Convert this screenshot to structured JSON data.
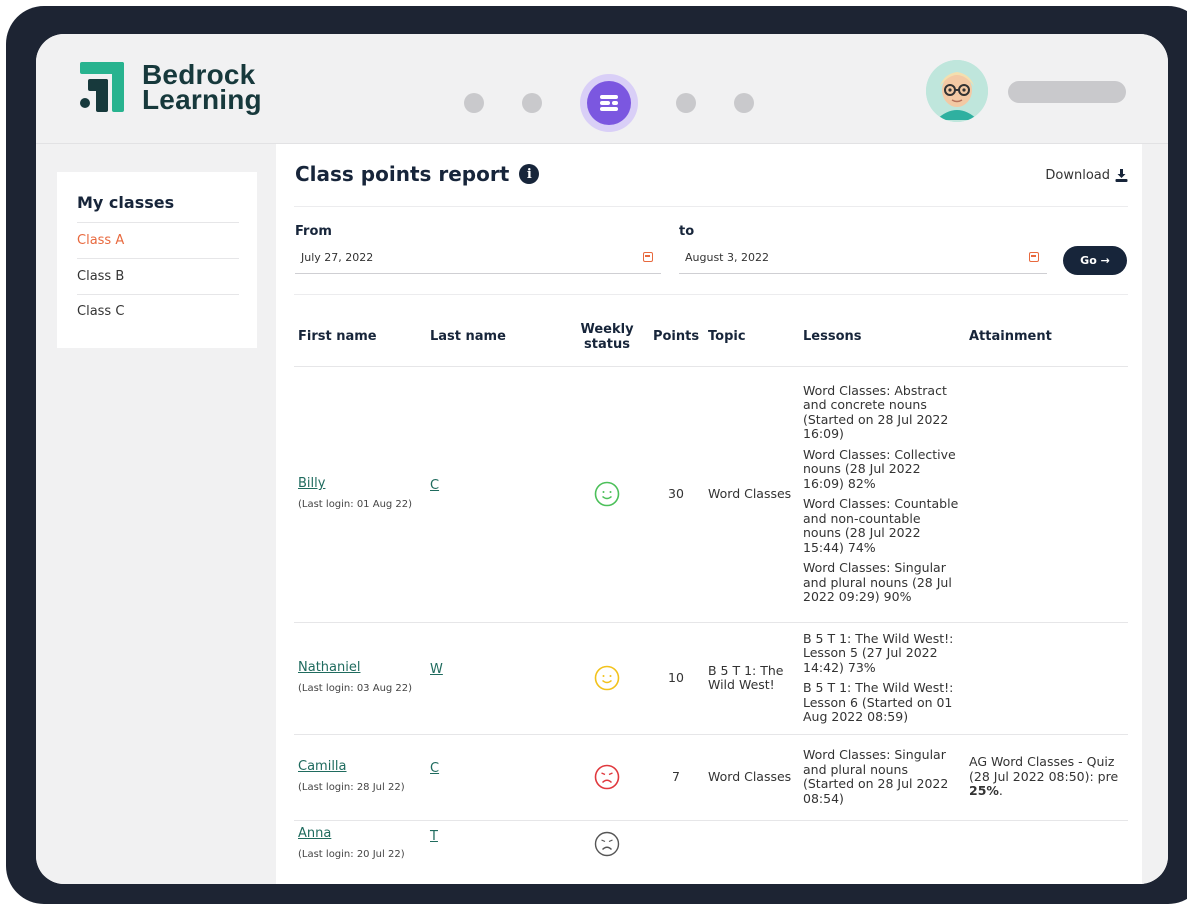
{
  "brand": {
    "line1": "Bedrock",
    "line2": "Learning"
  },
  "sidebar": {
    "heading": "My classes",
    "classes": [
      {
        "label": "Class A",
        "active": true
      },
      {
        "label": "Class B",
        "active": false
      },
      {
        "label": "Class C",
        "active": false
      }
    ]
  },
  "report": {
    "title": "Class points report",
    "download_label": "Download",
    "from_label": "From",
    "from_value": "July 27, 2022",
    "to_label": "to",
    "to_value": "August 3, 2022",
    "go_label": "Go →"
  },
  "table": {
    "headers": {
      "first_name": "First name",
      "last_name": "Last name",
      "weekly_status": "Weekly status",
      "points": "Points",
      "topic": "Topic",
      "lessons": "Lessons",
      "attainment": "Attainment"
    },
    "rows": [
      {
        "first_name": "Billy",
        "last_login": "(Last login: 01 Aug 22)",
        "last_name": "C",
        "status": "happy-green",
        "points": "30",
        "topic": "Word Classes",
        "lessons": [
          "Word Classes: Abstract and concrete nouns (Started on 28 Jul 2022 16:09)",
          "Word Classes: Collective nouns (28 Jul 2022 16:09) 82%",
          "Word Classes: Countable and non-countable nouns (28 Jul 2022 15:44) 74%",
          "Word Classes: Singular and plural nouns (28 Jul 2022 09:29) 90%"
        ],
        "attainment_pre": "",
        "attainment_bold": "",
        "attainment_post": ""
      },
      {
        "first_name": "Nathaniel",
        "last_login": "(Last login: 03 Aug 22)",
        "last_name": "W",
        "status": "happy-yellow",
        "points": "10",
        "topic": "B 5 T 1: The Wild West!",
        "lessons": [
          "B 5 T 1: The Wild West!: Lesson 5 (27 Jul 2022 14:42) 73%",
          "B 5 T 1: The Wild West!: Lesson 6 (Started on 01 Aug 2022 08:59)"
        ],
        "attainment_pre": "",
        "attainment_bold": "",
        "attainment_post": ""
      },
      {
        "first_name": "Camilla",
        "last_login": "(Last login: 28 Jul 22)",
        "last_name": "C",
        "status": "sad-red",
        "points": "7",
        "topic": "Word Classes",
        "lessons": [
          "Word Classes: Singular and plural nouns (Started on 28 Jul 2022 08:54)"
        ],
        "attainment_pre": "AG Word Classes - Quiz (28 Jul 2022 08:50): pre ",
        "attainment_bold": "25%",
        "attainment_post": "."
      },
      {
        "first_name": "Anna",
        "last_login": "(Last login: 20 Jul 22)",
        "last_name": "T",
        "status": "sad-grey",
        "points": "",
        "topic": "",
        "lessons": [],
        "attainment_pre": "",
        "attainment_bold": "",
        "attainment_post": ""
      }
    ]
  },
  "colors": {
    "accent_orange": "#e8693e",
    "navy": "#17253a",
    "brand_teal": "#1f6b5e",
    "nav_purple": "#7b57e0",
    "status_green": "#4cc05a",
    "status_yellow": "#f2c21b",
    "status_red": "#e0393e",
    "status_grey": "#555555"
  },
  "icons": {
    "info": "info-icon",
    "download": "download-icon",
    "calendar": "calendar-icon",
    "nav": "nav-menu-icon"
  }
}
